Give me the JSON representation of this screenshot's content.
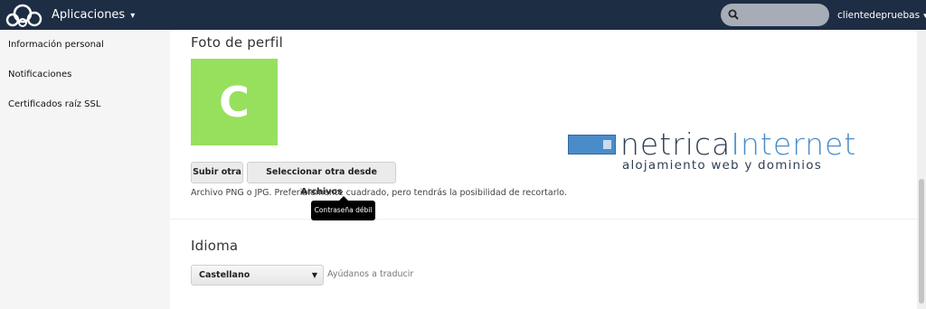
{
  "header": {
    "apps_label": "Aplicaciones",
    "caret": "▾",
    "search_placeholder": "",
    "user_name": "clientedepruebas",
    "logo_icon": "cloud-logo-icon",
    "search_icon": "search-icon"
  },
  "sidebar": {
    "items": [
      {
        "label": "Información personal"
      },
      {
        "label": "Notificaciones"
      },
      {
        "label": "Certificados raíz SSL"
      }
    ]
  },
  "profile": {
    "title": "Foto de perfil",
    "avatar_letter": "C",
    "avatar_color": "#97e05d",
    "upload_label": "Subir otra",
    "select_files_label": "Seleccionar otra desde Archivos",
    "hint": "Archivo PNG o JPG. Preferiblemente cuadrado, pero tendrás la posibilidad de recortarlo.",
    "tooltip": "Contraseña débil"
  },
  "language": {
    "title": "Idioma",
    "selected": "Castellano",
    "help_link": "Ayúdanos a traducir"
  },
  "watermark": {
    "brand_part1": "netrica",
    "brand_part2": "Internet",
    "tagline": "alojamiento web y dominios",
    "accent_color": "#4a8cc9"
  },
  "colors": {
    "header_bg": "#1d2d44",
    "main_bg": "#ffffff",
    "sidebar_bg": "#f5f5f5"
  }
}
